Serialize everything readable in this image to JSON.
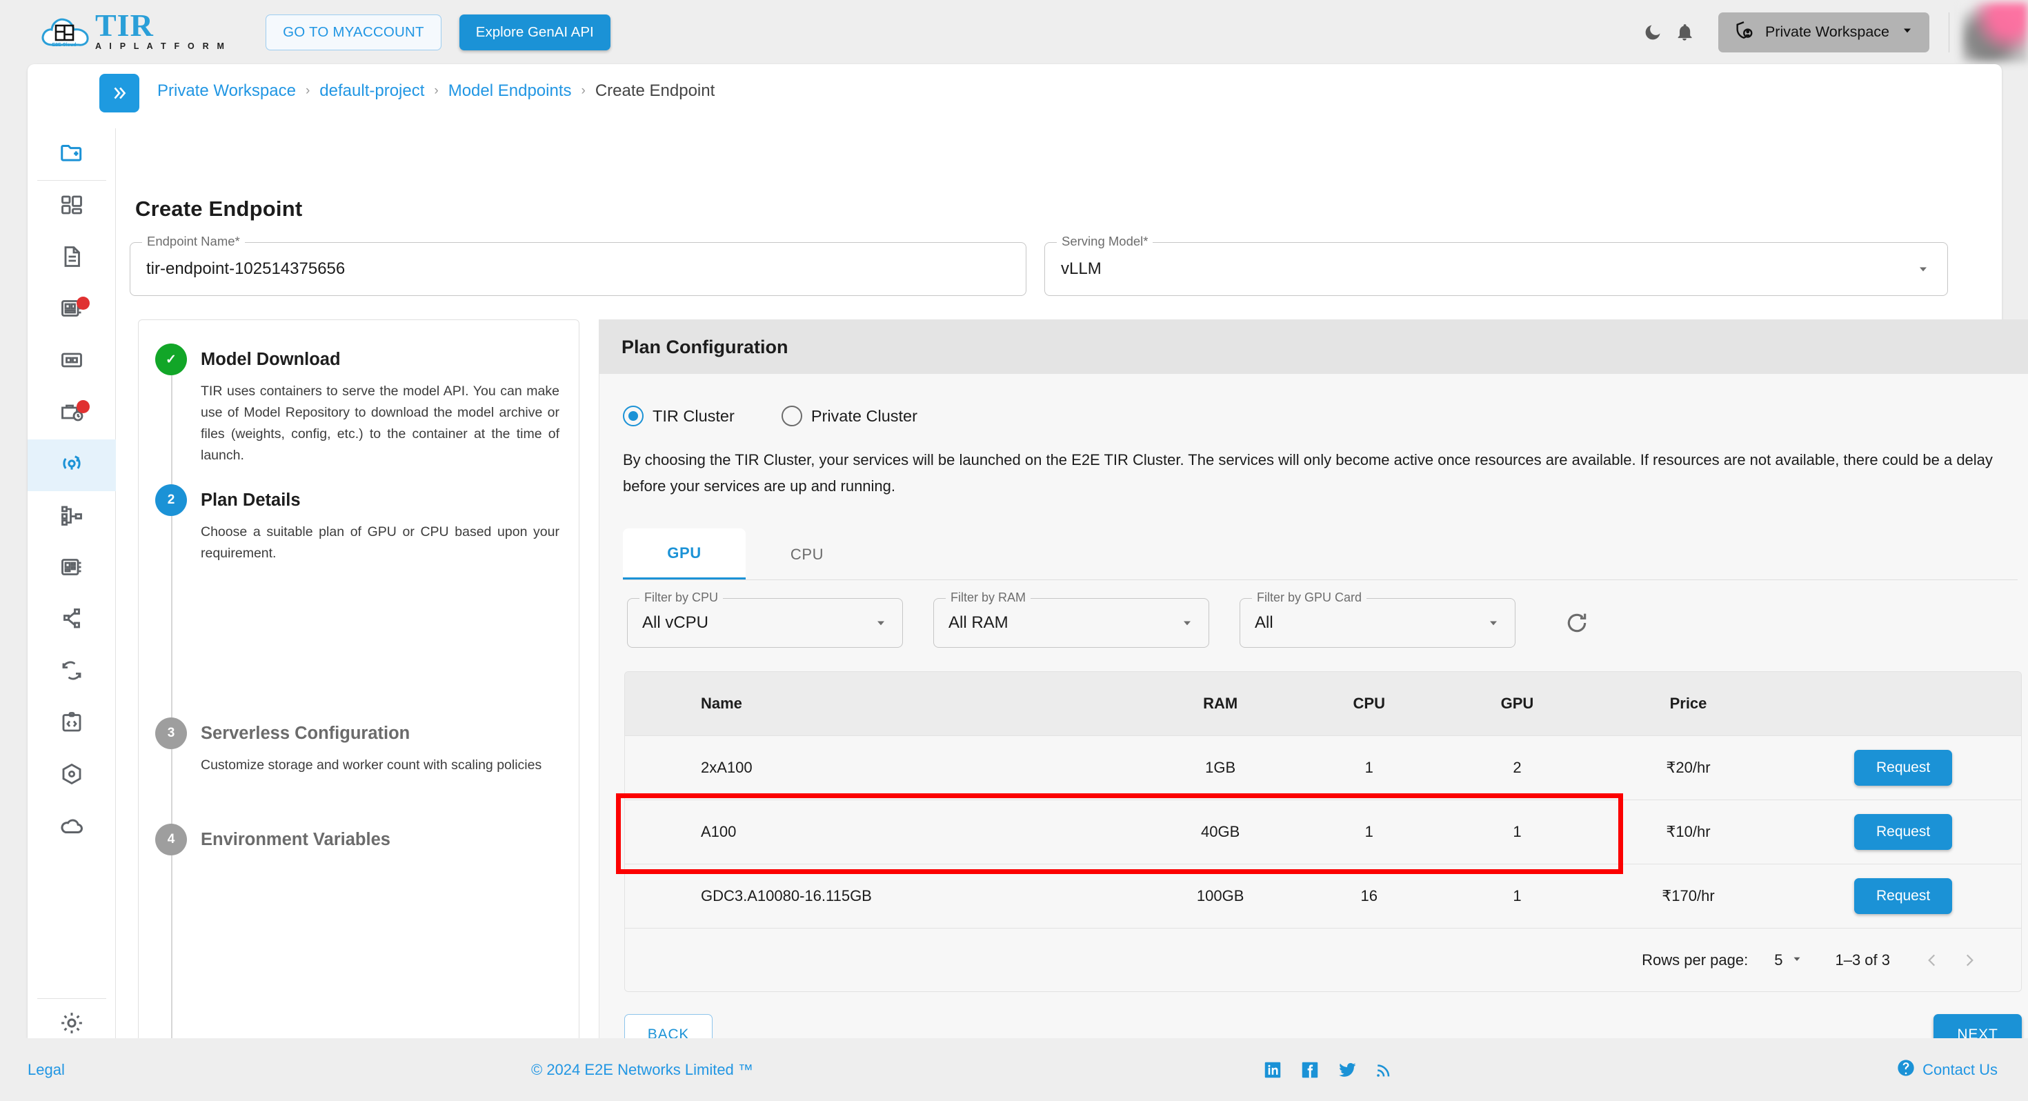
{
  "header": {
    "logo_title": "TIR",
    "logo_subtitle": "A I   P L A T F O R M",
    "logo_badge": "E2E Cloud",
    "myaccount_label": "GO TO MYACCOUNT",
    "genai_label": "Explore GenAI API",
    "dark_mode_icon": "moon-icon",
    "notifications_icon": "bell-icon",
    "workspace_icon": "shield-user-icon",
    "workspace_label": "Private Workspace",
    "workspace_caret": "chevron-down-icon"
  },
  "sidebar": {
    "items": [
      {
        "icon": "new-folder-icon",
        "name": "new-project",
        "active": false,
        "accent": true,
        "badge": false
      },
      {
        "icon": "dashboard-icon",
        "name": "dashboard",
        "active": false,
        "accent": false,
        "badge": false
      },
      {
        "icon": "document-icon",
        "name": "documents",
        "active": false,
        "accent": false,
        "badge": false
      },
      {
        "icon": "notebook-icon",
        "name": "notebooks",
        "active": false,
        "accent": false,
        "badge": true
      },
      {
        "icon": "grid-card-icon",
        "name": "datasets",
        "active": false,
        "accent": false,
        "badge": false
      },
      {
        "icon": "briefcase-clock-icon",
        "name": "jobs",
        "active": false,
        "accent": false,
        "badge": true
      },
      {
        "icon": "model-endpoint-icon",
        "name": "model-endpoints",
        "active": true,
        "accent": false,
        "badge": false
      },
      {
        "icon": "pipeline-icon",
        "name": "pipelines",
        "active": false,
        "accent": false,
        "badge": false
      },
      {
        "icon": "notebook-list-icon",
        "name": "model-repository",
        "active": false,
        "accent": false,
        "badge": false
      },
      {
        "icon": "share-nodes-icon",
        "name": "deployments",
        "active": false,
        "accent": false,
        "badge": false
      },
      {
        "icon": "sync-icon",
        "name": "fine-tuning",
        "active": false,
        "accent": false,
        "badge": false
      },
      {
        "icon": "code-clipboard-icon",
        "name": "api-tokens",
        "active": false,
        "accent": false,
        "badge": false
      },
      {
        "icon": "package-icon",
        "name": "containers",
        "active": false,
        "accent": false,
        "badge": false
      },
      {
        "icon": "cloud-icon",
        "name": "storage",
        "active": false,
        "accent": false,
        "badge": false
      }
    ],
    "bottom_items": [
      {
        "icon": "gear-icon",
        "name": "settings"
      },
      {
        "icon": "shield-user-icon",
        "name": "access-control"
      }
    ]
  },
  "breadcrumb": {
    "expand_icon": "double-chevron-right-icon",
    "items": [
      {
        "label": "Private Workspace",
        "link": true
      },
      {
        "label": "default-project",
        "link": true
      },
      {
        "label": "Model Endpoints",
        "link": true
      },
      {
        "label": "Create Endpoint",
        "link": false
      }
    ],
    "separator": "›"
  },
  "page": {
    "title": "Create Endpoint"
  },
  "form": {
    "endpoint_name": {
      "label": "Endpoint Name*",
      "value": "tir-endpoint-102514375656"
    },
    "serving_model": {
      "label": "Serving Model*",
      "value": "vLLM",
      "caret_icon": "chevron-down-icon"
    }
  },
  "stepper": {
    "steps": [
      {
        "bullet": "✓",
        "state": "done",
        "title": "Model Download",
        "desc": "TIR uses containers to serve the model API. You can make use of Model Repository to download the model archive or files (weights, config, etc.) to the container at the time of launch."
      },
      {
        "bullet": "2",
        "state": "active",
        "title": "Plan Details",
        "desc": "Choose a suitable plan of GPU or CPU based upon your requirement."
      },
      {
        "bullet": "3",
        "state": "idle",
        "title": "Serverless Configuration",
        "desc": "Customize storage and worker count with scaling policies"
      },
      {
        "bullet": "4",
        "state": "idle",
        "title": "Environment Variables",
        "desc": ""
      }
    ]
  },
  "plan": {
    "heading": "Plan Configuration",
    "cluster_options": [
      {
        "label": "TIR Cluster",
        "selected": true
      },
      {
        "label": "Private Cluster",
        "selected": false
      }
    ],
    "note": "By choosing the TIR Cluster, your services will be launched on the E2E TIR Cluster. The services will only become active once resources are available. If resources are not available, there could be a delay before your services are up and running.",
    "tabs": [
      {
        "label": "GPU",
        "active": true
      },
      {
        "label": "CPU",
        "active": false
      }
    ],
    "filters": [
      {
        "label": "Filter by CPU",
        "value": "All vCPU",
        "caret_icon": "chevron-down-icon"
      },
      {
        "label": "Filter by RAM",
        "value": "All RAM",
        "caret_icon": "chevron-down-icon"
      },
      {
        "label": "Filter by GPU Card",
        "value": "All",
        "caret_icon": "chevron-down-icon"
      }
    ],
    "refresh_icon": "refresh-icon",
    "highlight_color": "#fc0000",
    "table": {
      "columns": [
        "Name",
        "RAM",
        "CPU",
        "GPU",
        "Price",
        ""
      ],
      "rows": [
        {
          "name": "2xA100",
          "ram": "1GB",
          "cpu": "1",
          "gpu": "2",
          "price": "₹20/hr",
          "action": "Request"
        },
        {
          "name": "A100",
          "ram": "40GB",
          "cpu": "1",
          "gpu": "1",
          "price": "₹10/hr",
          "action": "Request"
        },
        {
          "name": "GDC3.A10080-16.115GB",
          "ram": "100GB",
          "cpu": "16",
          "gpu": "1",
          "price": "₹170/hr",
          "action": "Request"
        }
      ]
    },
    "pagination": {
      "rows_per_page_label": "Rows per page:",
      "rows_per_page_value": "5",
      "rows_per_page_caret": "chevron-down-icon",
      "range_label": "1–3 of 3",
      "prev_icon": "chevron-left-icon",
      "next_icon": "chevron-right-icon"
    },
    "back_label": "BACK",
    "next_label": "NEXT"
  },
  "footer": {
    "legal": "Legal",
    "copyright": "© 2024 E2E Networks Limited ™",
    "social": [
      "linkedin-icon",
      "facebook-icon",
      "twitter-icon",
      "rss-icon"
    ],
    "contact_icon": "help-circle-icon",
    "contact_label": "Contact Us"
  }
}
